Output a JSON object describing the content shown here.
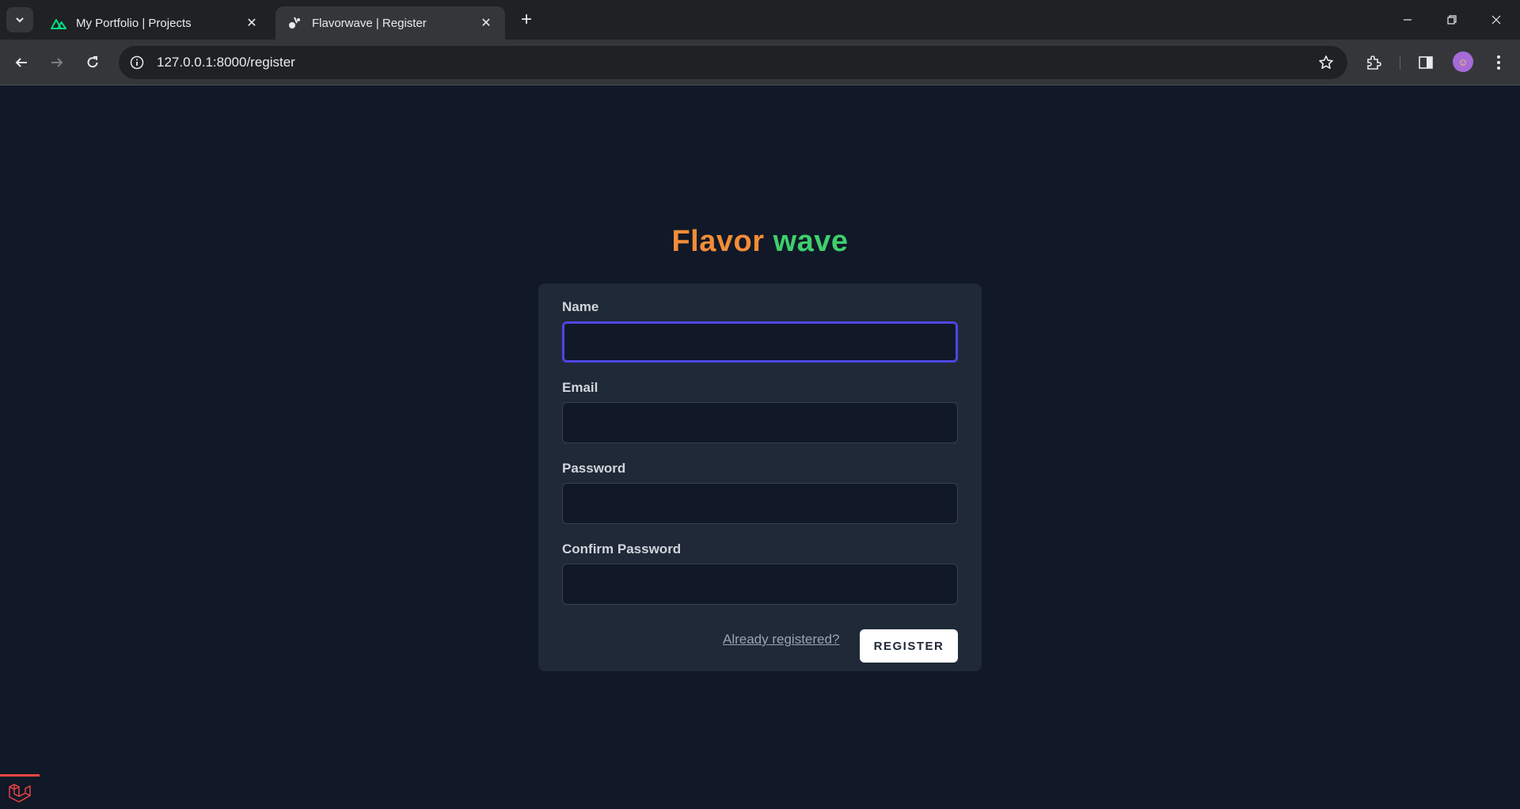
{
  "browser": {
    "tabs": [
      {
        "title": "My Portfolio | Projects",
        "favicon": "nuxt-logo-icon",
        "active": false
      },
      {
        "title": "Flavorwave | Register",
        "favicon": "flavorwave-icon",
        "active": true
      }
    ],
    "url": "127.0.0.1:8000/register"
  },
  "logo": {
    "part1": "Flavor",
    "part2": "wave"
  },
  "form": {
    "name_label": "Name",
    "email_label": "Email",
    "password_label": "Password",
    "confirm_label": "Confirm Password",
    "name_value": "",
    "email_value": "",
    "password_value": "",
    "confirm_value": "",
    "login_link": "Already registered?",
    "submit_label": "REGISTER"
  },
  "colors": {
    "page_bg": "#111827",
    "card_bg": "#1f2937",
    "logo_orange": "#f28c38",
    "logo_green": "#3ecf6e",
    "focus_ring": "#4f46e5"
  }
}
